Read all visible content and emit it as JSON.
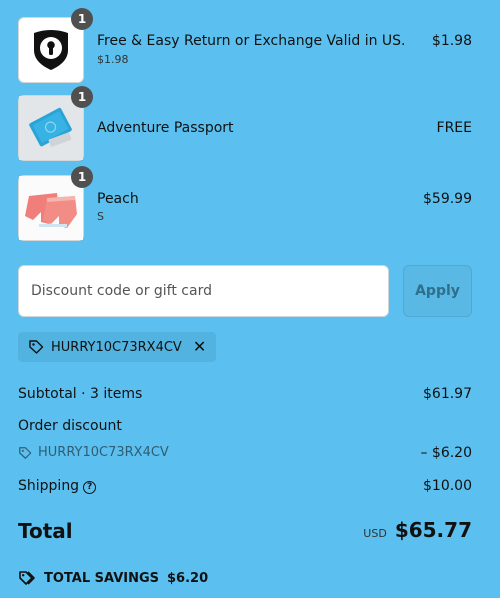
{
  "line_items": [
    {
      "title": "Free & Easy Return or Exchange Valid in US.",
      "subtitle": "$1.98",
      "price": "$1.98",
      "quantity": "1",
      "icon": "shield-keyhole-icon"
    },
    {
      "title": "Adventure Passport",
      "subtitle": "",
      "price": "FREE",
      "quantity": "1",
      "icon": "passport-image"
    },
    {
      "title": "Peach",
      "subtitle": "S",
      "price": "$59.99",
      "quantity": "1",
      "icon": "shorts-image"
    }
  ],
  "discount": {
    "placeholder": "Discount code or gift card",
    "apply_label": "Apply",
    "applied_code": "HURRY10C73RX4CV"
  },
  "summary": {
    "subtotal_label": "Subtotal · 3 items",
    "subtotal_value": "$61.97",
    "order_discount_label": "Order discount",
    "discount_code": "HURRY10C73RX4CV",
    "discount_value": "– $6.20",
    "shipping_label": "Shipping",
    "shipping_value": "$10.00",
    "total_label": "Total",
    "currency": "USD",
    "total_value": "$65.77",
    "savings_label": "TOTAL SAVINGS",
    "savings_value": "$6.20"
  },
  "colors": {
    "background": "#5bc0ef",
    "badge": "#505050",
    "muted_text": "#2f5e73"
  }
}
